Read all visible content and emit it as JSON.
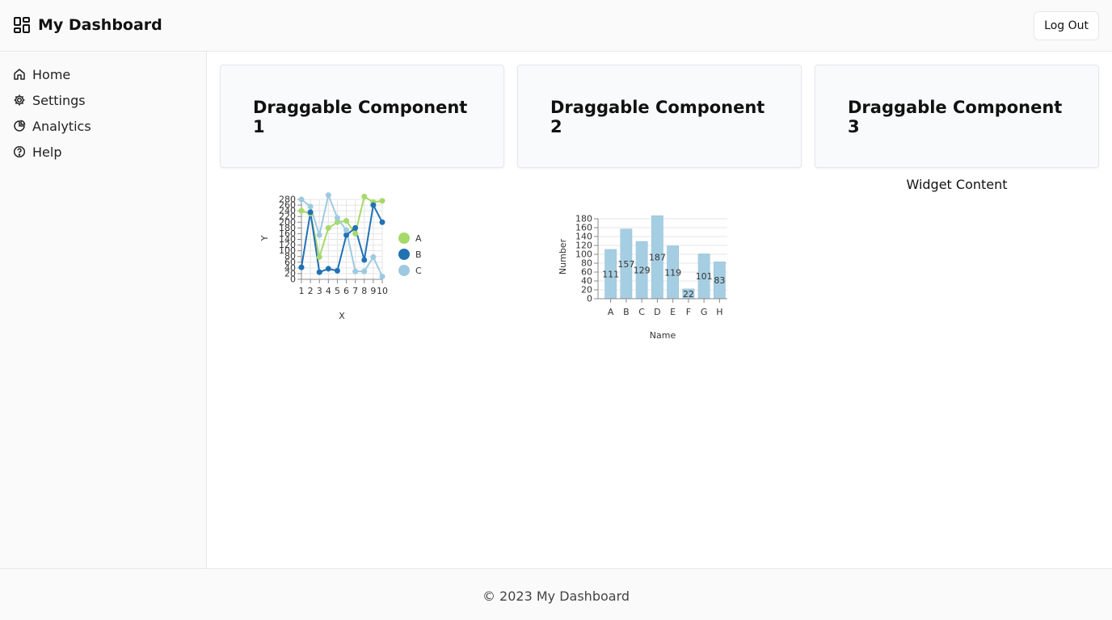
{
  "header": {
    "brand_icon": "dashboard-icon",
    "title": "My Dashboard",
    "logout_label": "Log Out"
  },
  "sidebar": {
    "items": [
      {
        "label": "Home",
        "icon": "home-icon"
      },
      {
        "label": "Settings",
        "icon": "gear-icon"
      },
      {
        "label": "Analytics",
        "icon": "pie-chart-icon"
      },
      {
        "label": "Help",
        "icon": "help-icon"
      }
    ]
  },
  "cards": [
    {
      "title": "Draggable Component 1"
    },
    {
      "title": "Draggable Component 2"
    },
    {
      "title": "Draggable Component 3"
    }
  ],
  "widget": {
    "content": "Widget Content"
  },
  "footer": {
    "text": "© 2023 My Dashboard"
  },
  "chart_data": [
    {
      "type": "line",
      "xlabel": "X",
      "ylabel": "Y",
      "x": [
        1,
        2,
        3,
        4,
        5,
        6,
        7,
        8,
        9,
        10
      ],
      "yticks": [
        0,
        20,
        40,
        60,
        80,
        100,
        120,
        140,
        160,
        180,
        200,
        220,
        240,
        260,
        280
      ],
      "ylim": [
        0,
        280
      ],
      "grid": true,
      "legend": "right",
      "series": [
        {
          "name": "A",
          "color": "#a6d96a",
          "values": [
            240,
            230,
            78,
            180,
            200,
            205,
            160,
            290,
            270,
            275
          ]
        },
        {
          "name": "B",
          "color": "#2171b5",
          "values": [
            42,
            235,
            25,
            37,
            30,
            155,
            180,
            68,
            260,
            200
          ]
        },
        {
          "name": "C",
          "color": "#9ecae1",
          "values": [
            280,
            255,
            155,
            295,
            215,
            172,
            28,
            28,
            78,
            10
          ]
        }
      ]
    },
    {
      "type": "bar",
      "xlabel": "Name",
      "ylabel": "Number",
      "categories": [
        "A",
        "B",
        "C",
        "D",
        "E",
        "F",
        "G",
        "H"
      ],
      "values": [
        111,
        157,
        129,
        187,
        119,
        22,
        101,
        83
      ],
      "yticks": [
        0,
        20,
        40,
        60,
        80,
        100,
        120,
        140,
        160,
        180
      ],
      "ylim": [
        0,
        180
      ],
      "grid": true,
      "color": "#a6cee3"
    }
  ]
}
